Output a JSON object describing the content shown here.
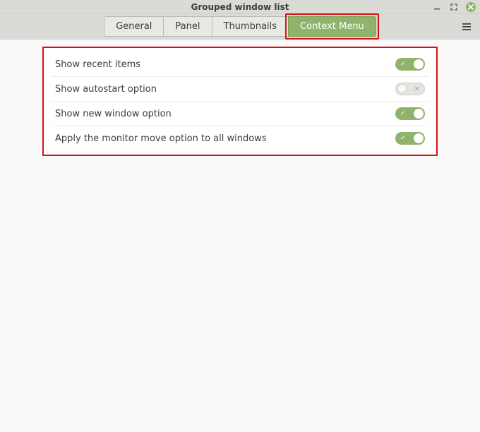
{
  "window": {
    "title": "Grouped window list"
  },
  "tabs": {
    "general": "General",
    "panel": "Panel",
    "thumbnails": "Thumbnails",
    "context_menu": "Context Menu",
    "active": "context_menu"
  },
  "settings": {
    "rows": [
      {
        "label": "Show recent items",
        "value": true
      },
      {
        "label": "Show autostart option",
        "value": false
      },
      {
        "label": "Show new window option",
        "value": true
      },
      {
        "label": "Apply the monitor move option to all windows",
        "value": true
      }
    ]
  },
  "colors": {
    "accent": "#8fb36b",
    "highlight": "#d31313"
  }
}
